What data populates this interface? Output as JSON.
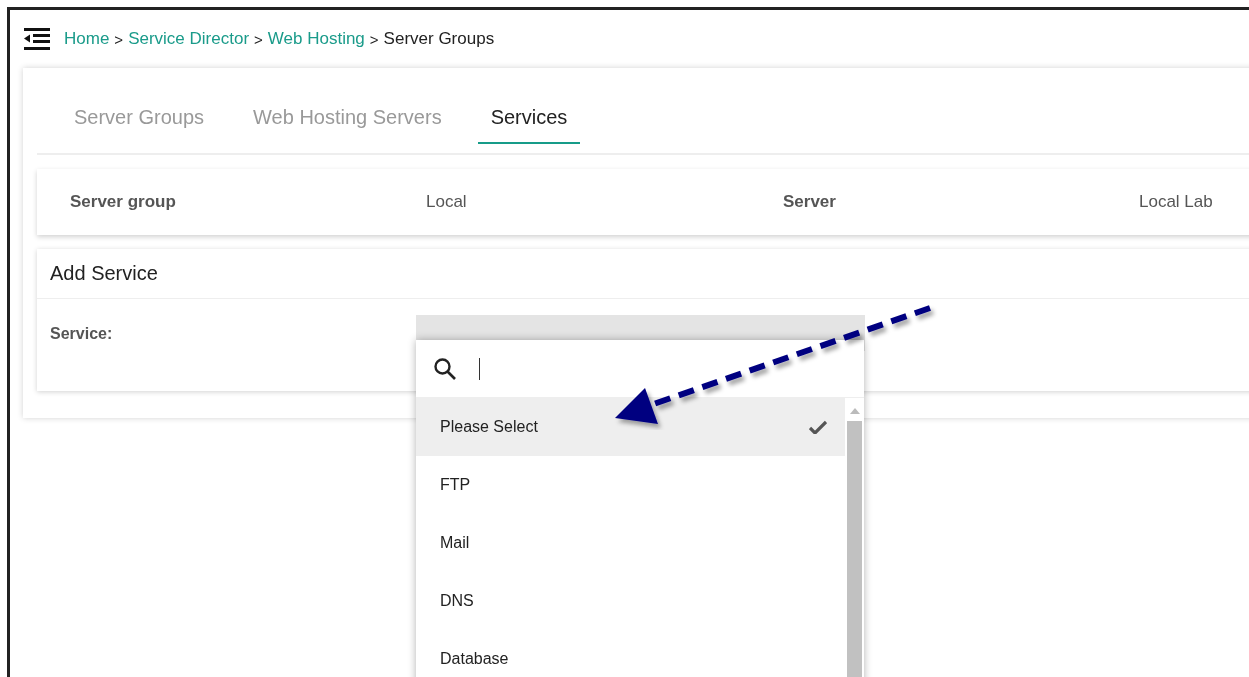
{
  "breadcrumb": {
    "separator": ">",
    "items": [
      {
        "label": "Home",
        "link": true
      },
      {
        "label": "Service Director",
        "link": true
      },
      {
        "label": "Web Hosting",
        "link": true
      },
      {
        "label": "Server Groups",
        "link": false
      }
    ]
  },
  "tabs": [
    {
      "label": "Server Groups",
      "selected": false
    },
    {
      "label": "Web Hosting Servers",
      "selected": false
    },
    {
      "label": "Services",
      "selected": true
    }
  ],
  "summary": [
    {
      "label": "Server group",
      "kind": "label"
    },
    {
      "label": "Local",
      "kind": "value"
    },
    {
      "label": "Server",
      "kind": "label"
    },
    {
      "label": "Local Lab",
      "kind": "value"
    }
  ],
  "add_service": {
    "title": "Add Service",
    "field_label": "Service:",
    "dropdown": {
      "options": [
        {
          "label": "Please Select",
          "selected": true
        },
        {
          "label": "FTP",
          "selected": false
        },
        {
          "label": "Mail",
          "selected": false
        },
        {
          "label": "DNS",
          "selected": false
        },
        {
          "label": "Database",
          "selected": false
        }
      ]
    }
  }
}
